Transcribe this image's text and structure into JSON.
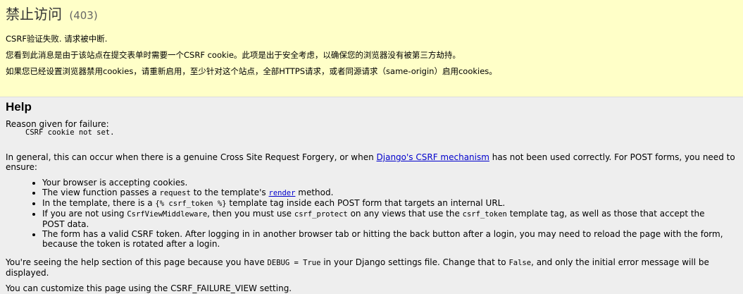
{
  "title": "禁止访问",
  "status_code": "(403)",
  "summary_lines": [
    "CSRF验证失败. 请求被中断.",
    "您看到此消息是由于该站点在提交表单时需要一个CSRF cookie。此项是出于安全考虑，以确保您的浏览器没有被第三方劫持。",
    "如果您已经设置浏览器禁用cookies，请重新启用，至少针对这个站点，全部HTTPS请求，或者同源请求（same-origin）启用cookies。"
  ],
  "help": {
    "heading": "Help",
    "reason_label": "Reason given for failure:",
    "reason_value": "CSRF cookie not set.",
    "general_pre": "In general, this can occur when there is a genuine Cross Site Request Forgery, or when ",
    "general_link": "Django's CSRF mechanism",
    "general_post": " has not been used correctly. For POST forms, you need to ensure:",
    "bullets": {
      "b1": "Your browser is accepting cookies.",
      "b2_pre": "The view function passes a ",
      "b2_code": "request",
      "b2_mid": " to the template's ",
      "b2_link": "render",
      "b2_post": " method.",
      "b3_pre": "In the template, there is a ",
      "b3_code": "{% csrf_token %}",
      "b3_post": " template tag inside each POST form that targets an internal URL.",
      "b4_pre": "If you are not using ",
      "b4_code1": "CsrfViewMiddleware",
      "b4_mid1": ", then you must use ",
      "b4_code2": "csrf_protect",
      "b4_mid2": " on any views that use the ",
      "b4_code3": "csrf_token",
      "b4_post": " template tag, as well as those that accept the",
      "b4_line2": "POST data.",
      "b5_line1": "The form has a valid CSRF token. After logging in in another browser tab or hitting the back button after a login, you may need to reload the page with the form,",
      "b5_line2": "because the token is rotated after a login."
    },
    "debug_pre": "You're seeing the help section of this page because you have ",
    "debug_code1": "DEBUG = True",
    "debug_mid": " in your Django settings file. Change that to ",
    "debug_code2": "False",
    "debug_post": ", and only the initial error message will be displayed.",
    "customize": "You can customize this page using the CSRF_FAILURE_VIEW setting."
  }
}
